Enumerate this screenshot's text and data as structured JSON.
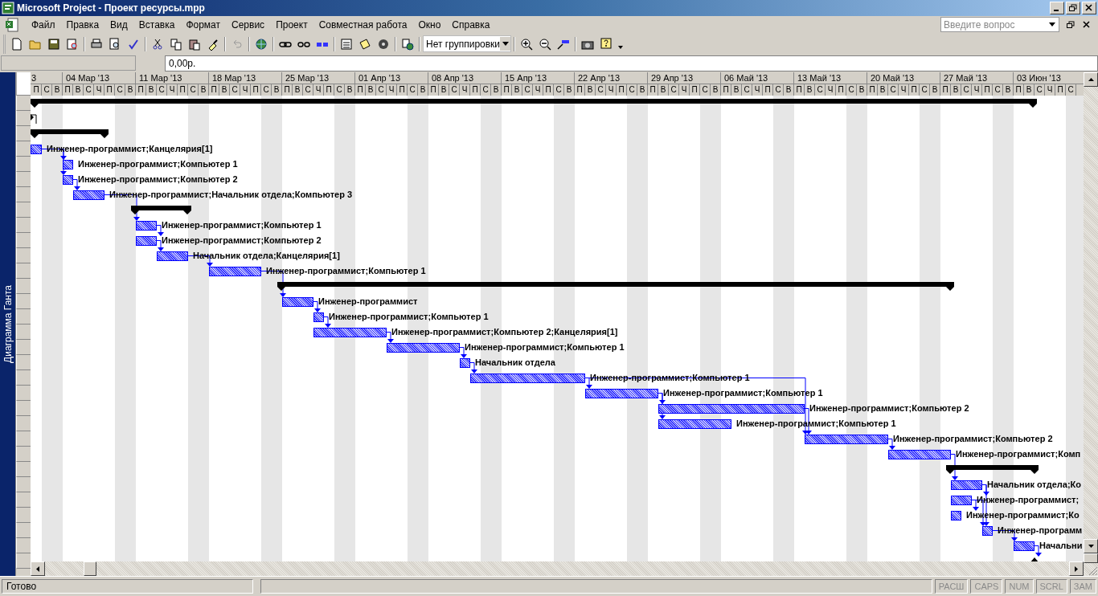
{
  "window": {
    "title": "Microsoft Project - Проект ресурсы.mpp"
  },
  "menu": [
    {
      "label": "Файл"
    },
    {
      "label": "Правка"
    },
    {
      "label": "Вид"
    },
    {
      "label": "Вставка"
    },
    {
      "label": "Формат"
    },
    {
      "label": "Сервис"
    },
    {
      "label": "Проект"
    },
    {
      "label": "Совместная работа"
    },
    {
      "label": "Окно"
    },
    {
      "label": "Справка"
    }
  ],
  "help_search": {
    "placeholder": "Введите вопрос"
  },
  "toolbar": {
    "grouping": "Нет группировки"
  },
  "entry_bar": {
    "value": "0,00р."
  },
  "view_bar": {
    "label": "Диаграмма Ганта"
  },
  "timescale": {
    "first_partial": "3",
    "weeks": [
      "04 Мар '13",
      "11 Мар '13",
      "18 Мар '13",
      "25 Мар '13",
      "01 Апр '13",
      "08 Апр '13",
      "15 Апр '13",
      "22 Апр '13",
      "29 Апр '13",
      "06 Май '13",
      "13 Май '13",
      "20 Май '13",
      "27 Май '13",
      "03 Июн '13"
    ],
    "days": [
      "П",
      "С",
      "В",
      "П",
      "В",
      "С",
      "Ч",
      "П",
      "С",
      "В",
      "П",
      "В",
      "С",
      "Ч",
      "П",
      "С",
      "В",
      "П",
      "В",
      "С",
      "Ч",
      "П",
      "С",
      "В",
      "П",
      "В",
      "С",
      "Ч",
      "П",
      "С",
      "В",
      "П",
      "В",
      "С",
      "Ч",
      "П",
      "С",
      "В",
      "П",
      "В",
      "С",
      "Ч",
      "П",
      "С",
      "В",
      "П",
      "В",
      "С",
      "Ч",
      "П",
      "С",
      "В",
      "П",
      "В",
      "С",
      "Ч",
      "П",
      "С",
      "В",
      "П",
      "В",
      "С",
      "Ч",
      "П",
      "С",
      "В",
      "П",
      "В",
      "С",
      "Ч",
      "П",
      "С",
      "В",
      "П",
      "В",
      "С",
      "Ч",
      "П",
      "С",
      "В",
      "П",
      "В",
      "С",
      "Ч",
      "П",
      "С",
      "В",
      "П",
      "В",
      "С",
      "Ч",
      "П",
      "С",
      "В",
      "П",
      "В",
      "С",
      "Ч",
      "П",
      "С"
    ]
  },
  "tasks": [
    {
      "kind": "summary"
    },
    {
      "kind": "marker"
    },
    {
      "kind": "summary"
    },
    {
      "kind": "task",
      "resources": "Инженер-программист;Канцелярия[1]"
    },
    {
      "kind": "task",
      "resources": "Инженер-программист;Компьютер 1"
    },
    {
      "kind": "task",
      "resources": "Инженер-программист;Компьютер 2"
    },
    {
      "kind": "task",
      "resources": "Инженер-программист;Начальник отдела;Компьютер 3"
    },
    {
      "kind": "summary"
    },
    {
      "kind": "task",
      "resources": "Инженер-программист;Компьютер 1"
    },
    {
      "kind": "task",
      "resources": "Инженер-программист;Компьютер 2"
    },
    {
      "kind": "task",
      "resources": "Начальник отдела;Канцелярия[1]"
    },
    {
      "kind": "task",
      "resources": "Инженер-программист;Компьютер 1"
    },
    {
      "kind": "summary"
    },
    {
      "kind": "task",
      "resources": "Инженер-программист"
    },
    {
      "kind": "task",
      "resources": "Инженер-программист;Компьютер 1"
    },
    {
      "kind": "task",
      "resources": "Инженер-программист;Компьютер 2;Канцелярия[1]"
    },
    {
      "kind": "task",
      "resources": "Инженер-программист;Компьютер 1"
    },
    {
      "kind": "task",
      "resources": "Начальник отдела"
    },
    {
      "kind": "task",
      "resources": "Инженер-программист;Компьютер 1"
    },
    {
      "kind": "task",
      "resources": "Инженер-программист;Компьютер 1"
    },
    {
      "kind": "task",
      "resources": "Инженер-программист;Компьютер 2"
    },
    {
      "kind": "task",
      "resources": "Инженер-программист;Компьютер 1"
    },
    {
      "kind": "task",
      "resources": "Инженер-программист;Компьютер 2"
    },
    {
      "kind": "task",
      "resources": "Инженер-программист;Комп"
    },
    {
      "kind": "summary"
    },
    {
      "kind": "task",
      "resources": "Начальник отдела;Ко"
    },
    {
      "kind": "task",
      "resources": "Инженер-программист;"
    },
    {
      "kind": "task",
      "resources": "Инженер-программист;Ко"
    },
    {
      "kind": "task",
      "resources": "Инженер-программ"
    },
    {
      "kind": "task",
      "resources": "Начальни"
    },
    {
      "kind": "milestone"
    }
  ],
  "status_bar": {
    "message": "Готово",
    "indicators": [
      {
        "label": "РАСШ",
        "on": false
      },
      {
        "label": "CAPS",
        "on": false
      },
      {
        "label": "NUM",
        "on": false
      },
      {
        "label": "SCRL",
        "on": false
      },
      {
        "label": "ЗАМ",
        "on": false
      }
    ]
  }
}
